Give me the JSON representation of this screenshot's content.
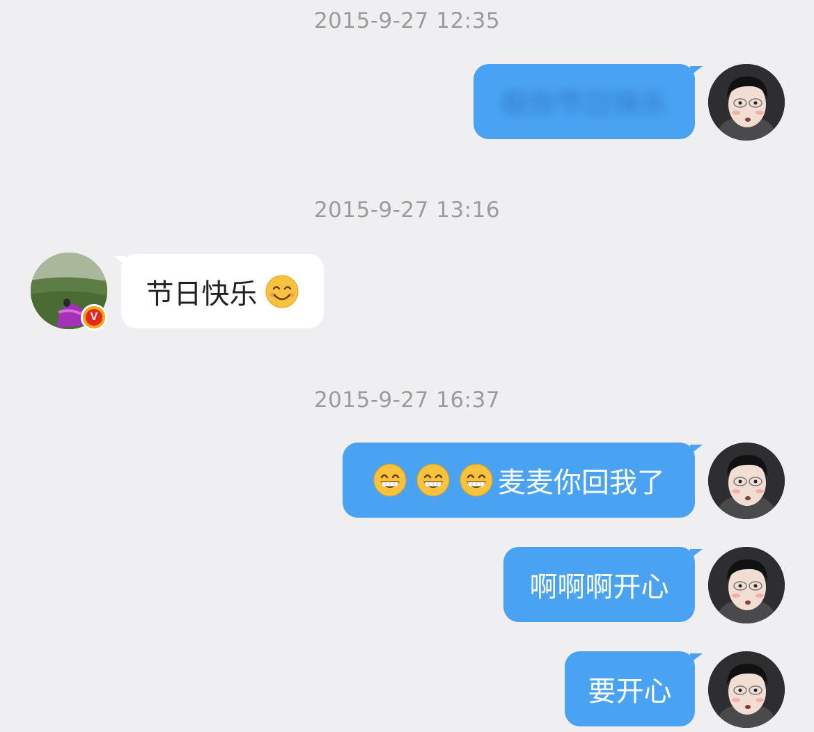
{
  "messages": [
    {
      "timestamp": "2015-9-27 12:35",
      "text": "祝你节日快乐",
      "direction": "outgoing",
      "blurred": true
    },
    {
      "timestamp": "2015-9-27 13:16",
      "text": "节日快乐",
      "emoji": "smiling-face-emoji",
      "direction": "incoming"
    },
    {
      "timestamp": "2015-9-27 16:37",
      "text": "麦麦你回我了",
      "emoji": "grinning-face-emoji",
      "emoji_count": 3,
      "direction": "outgoing"
    },
    {
      "text": "啊啊啊开心",
      "direction": "outgoing"
    },
    {
      "text": "要开心",
      "direction": "outgoing"
    }
  ],
  "contact": {
    "verified_badge": "V"
  },
  "colors": {
    "background": "#efeff1",
    "outgoing_bubble": "#4aa3f2",
    "incoming_bubble": "#ffffff",
    "timestamp": "#9b9b9b",
    "badge": "#f6a316"
  }
}
